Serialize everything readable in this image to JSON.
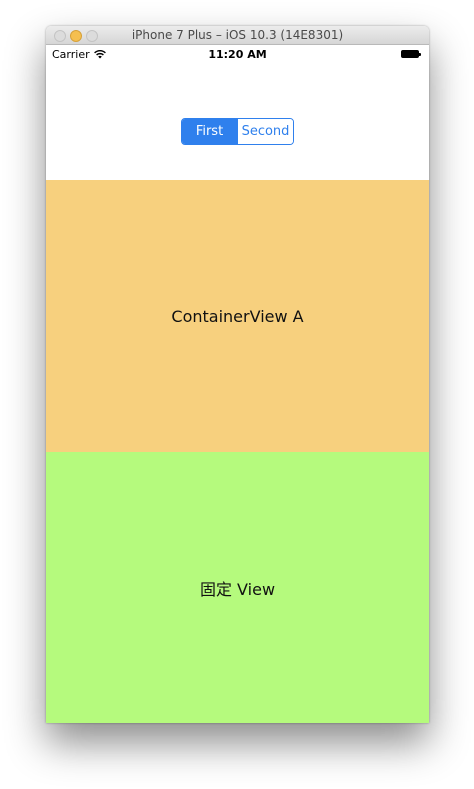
{
  "window": {
    "title": "iPhone 7 Plus – iOS 10.3 (14E8301)"
  },
  "statusbar": {
    "carrier": "Carrier",
    "time": "11:20 AM",
    "wifi_icon": "wifi-icon",
    "battery_icon": "battery-icon"
  },
  "segmented_control": {
    "segments": [
      {
        "label": "First",
        "selected": true
      },
      {
        "label": "Second",
        "selected": false
      }
    ],
    "accent_color": "#2f80ed"
  },
  "container_a": {
    "label": "ContainerView A",
    "background": "#f7d07e"
  },
  "fixed_view": {
    "label": "固定 View",
    "background": "#b5fa7d"
  }
}
